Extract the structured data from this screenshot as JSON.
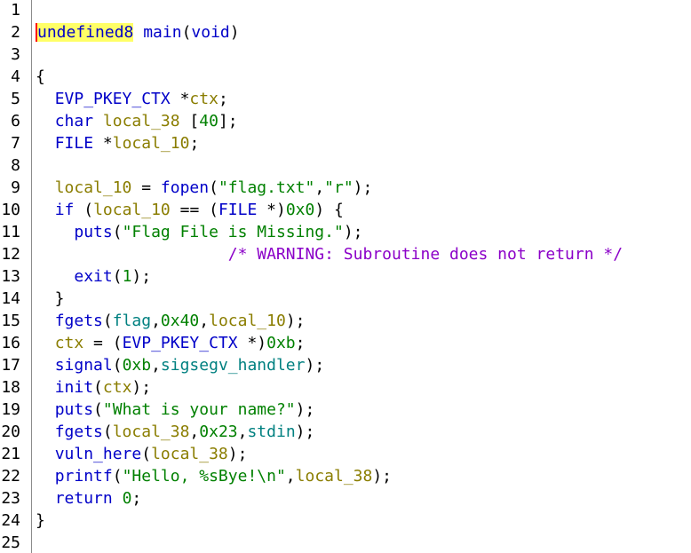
{
  "colors": {
    "type": "#0000c8",
    "function": "#0000c8",
    "variable": "#8a7d00",
    "global": "#008080",
    "number": "#008000",
    "string": "#008000",
    "comment": "#8b00c8",
    "highlight": "#ffff66",
    "cursor": "#ff0000"
  },
  "lines": [
    {
      "n": "1",
      "tokens": []
    },
    {
      "n": "2",
      "tokens": [
        {
          "t": "undefined8",
          "c": "type",
          "hl": true
        },
        {
          "t": " ",
          "c": "plain"
        },
        {
          "t": "main",
          "c": "func"
        },
        {
          "t": "(",
          "c": "plain"
        },
        {
          "t": "void",
          "c": "type"
        },
        {
          "t": ")",
          "c": "plain"
        }
      ]
    },
    {
      "n": "3",
      "tokens": []
    },
    {
      "n": "4",
      "tokens": [
        {
          "t": "{",
          "c": "plain"
        }
      ]
    },
    {
      "n": "5",
      "tokens": [
        {
          "t": "  ",
          "c": "plain"
        },
        {
          "t": "EVP_PKEY_CTX",
          "c": "type"
        },
        {
          "t": " *",
          "c": "plain"
        },
        {
          "t": "ctx",
          "c": "var"
        },
        {
          "t": ";",
          "c": "plain"
        }
      ]
    },
    {
      "n": "6",
      "tokens": [
        {
          "t": "  ",
          "c": "plain"
        },
        {
          "t": "char",
          "c": "type"
        },
        {
          "t": " ",
          "c": "plain"
        },
        {
          "t": "local_38",
          "c": "var"
        },
        {
          "t": " [",
          "c": "plain"
        },
        {
          "t": "40",
          "c": "num"
        },
        {
          "t": "];",
          "c": "plain"
        }
      ]
    },
    {
      "n": "7",
      "tokens": [
        {
          "t": "  ",
          "c": "plain"
        },
        {
          "t": "FILE",
          "c": "type"
        },
        {
          "t": " *",
          "c": "plain"
        },
        {
          "t": "local_10",
          "c": "var"
        },
        {
          "t": ";",
          "c": "plain"
        }
      ]
    },
    {
      "n": "8",
      "tokens": []
    },
    {
      "n": "9",
      "tokens": [
        {
          "t": "  ",
          "c": "plain"
        },
        {
          "t": "local_10",
          "c": "var"
        },
        {
          "t": " = ",
          "c": "plain"
        },
        {
          "t": "fopen",
          "c": "func"
        },
        {
          "t": "(",
          "c": "plain"
        },
        {
          "t": "\"flag.txt\"",
          "c": "str"
        },
        {
          "t": ",",
          "c": "plain"
        },
        {
          "t": "\"r\"",
          "c": "str"
        },
        {
          "t": ");",
          "c": "plain"
        }
      ]
    },
    {
      "n": "10",
      "tokens": [
        {
          "t": "  ",
          "c": "plain"
        },
        {
          "t": "if",
          "c": "kw"
        },
        {
          "t": " (",
          "c": "plain"
        },
        {
          "t": "local_10",
          "c": "var"
        },
        {
          "t": " == (",
          "c": "plain"
        },
        {
          "t": "FILE",
          "c": "type"
        },
        {
          "t": " *)",
          "c": "plain"
        },
        {
          "t": "0x0",
          "c": "num"
        },
        {
          "t": ") {",
          "c": "plain"
        }
      ]
    },
    {
      "n": "11",
      "tokens": [
        {
          "t": "    ",
          "c": "plain"
        },
        {
          "t": "puts",
          "c": "func"
        },
        {
          "t": "(",
          "c": "plain"
        },
        {
          "t": "\"Flag File is Missing.\"",
          "c": "str"
        },
        {
          "t": ");",
          "c": "plain"
        }
      ]
    },
    {
      "n": "12",
      "tokens": [
        {
          "t": "                    ",
          "c": "plain"
        },
        {
          "t": "/* WARNING: Subroutine does not return */",
          "c": "com"
        }
      ]
    },
    {
      "n": "13",
      "tokens": [
        {
          "t": "    ",
          "c": "plain"
        },
        {
          "t": "exit",
          "c": "func"
        },
        {
          "t": "(",
          "c": "plain"
        },
        {
          "t": "1",
          "c": "num"
        },
        {
          "t": ");",
          "c": "plain"
        }
      ]
    },
    {
      "n": "14",
      "tokens": [
        {
          "t": "  }",
          "c": "plain"
        }
      ]
    },
    {
      "n": "15",
      "tokens": [
        {
          "t": "  ",
          "c": "plain"
        },
        {
          "t": "fgets",
          "c": "func"
        },
        {
          "t": "(",
          "c": "plain"
        },
        {
          "t": "flag",
          "c": "glob"
        },
        {
          "t": ",",
          "c": "plain"
        },
        {
          "t": "0x40",
          "c": "num"
        },
        {
          "t": ",",
          "c": "plain"
        },
        {
          "t": "local_10",
          "c": "var"
        },
        {
          "t": ");",
          "c": "plain"
        }
      ]
    },
    {
      "n": "16",
      "tokens": [
        {
          "t": "  ",
          "c": "plain"
        },
        {
          "t": "ctx",
          "c": "var"
        },
        {
          "t": " = (",
          "c": "plain"
        },
        {
          "t": "EVP_PKEY_CTX",
          "c": "type"
        },
        {
          "t": " *)",
          "c": "plain"
        },
        {
          "t": "0xb",
          "c": "num"
        },
        {
          "t": ";",
          "c": "plain"
        }
      ]
    },
    {
      "n": "17",
      "tokens": [
        {
          "t": "  ",
          "c": "plain"
        },
        {
          "t": "signal",
          "c": "func"
        },
        {
          "t": "(",
          "c": "plain"
        },
        {
          "t": "0xb",
          "c": "num"
        },
        {
          "t": ",",
          "c": "plain"
        },
        {
          "t": "sigsegv_handler",
          "c": "glob"
        },
        {
          "t": ");",
          "c": "plain"
        }
      ]
    },
    {
      "n": "18",
      "tokens": [
        {
          "t": "  ",
          "c": "plain"
        },
        {
          "t": "init",
          "c": "func"
        },
        {
          "t": "(",
          "c": "plain"
        },
        {
          "t": "ctx",
          "c": "var"
        },
        {
          "t": ");",
          "c": "plain"
        }
      ]
    },
    {
      "n": "19",
      "tokens": [
        {
          "t": "  ",
          "c": "plain"
        },
        {
          "t": "puts",
          "c": "func"
        },
        {
          "t": "(",
          "c": "plain"
        },
        {
          "t": "\"What is your name?\"",
          "c": "str"
        },
        {
          "t": ");",
          "c": "plain"
        }
      ]
    },
    {
      "n": "20",
      "tokens": [
        {
          "t": "  ",
          "c": "plain"
        },
        {
          "t": "fgets",
          "c": "func"
        },
        {
          "t": "(",
          "c": "plain"
        },
        {
          "t": "local_38",
          "c": "var"
        },
        {
          "t": ",",
          "c": "plain"
        },
        {
          "t": "0x23",
          "c": "num"
        },
        {
          "t": ",",
          "c": "plain"
        },
        {
          "t": "stdin",
          "c": "glob"
        },
        {
          "t": ");",
          "c": "plain"
        }
      ]
    },
    {
      "n": "21",
      "tokens": [
        {
          "t": "  ",
          "c": "plain"
        },
        {
          "t": "vuln_here",
          "c": "func"
        },
        {
          "t": "(",
          "c": "plain"
        },
        {
          "t": "local_38",
          "c": "var"
        },
        {
          "t": ");",
          "c": "plain"
        }
      ]
    },
    {
      "n": "22",
      "tokens": [
        {
          "t": "  ",
          "c": "plain"
        },
        {
          "t": "printf",
          "c": "func"
        },
        {
          "t": "(",
          "c": "plain"
        },
        {
          "t": "\"Hello, %sBye!\\n\"",
          "c": "str"
        },
        {
          "t": ",",
          "c": "plain"
        },
        {
          "t": "local_38",
          "c": "var"
        },
        {
          "t": ");",
          "c": "plain"
        }
      ]
    },
    {
      "n": "23",
      "tokens": [
        {
          "t": "  ",
          "c": "plain"
        },
        {
          "t": "return",
          "c": "kw"
        },
        {
          "t": " ",
          "c": "plain"
        },
        {
          "t": "0",
          "c": "num"
        },
        {
          "t": ";",
          "c": "plain"
        }
      ]
    },
    {
      "n": "24",
      "tokens": [
        {
          "t": "}",
          "c": "plain"
        }
      ]
    },
    {
      "n": "25",
      "tokens": []
    }
  ]
}
